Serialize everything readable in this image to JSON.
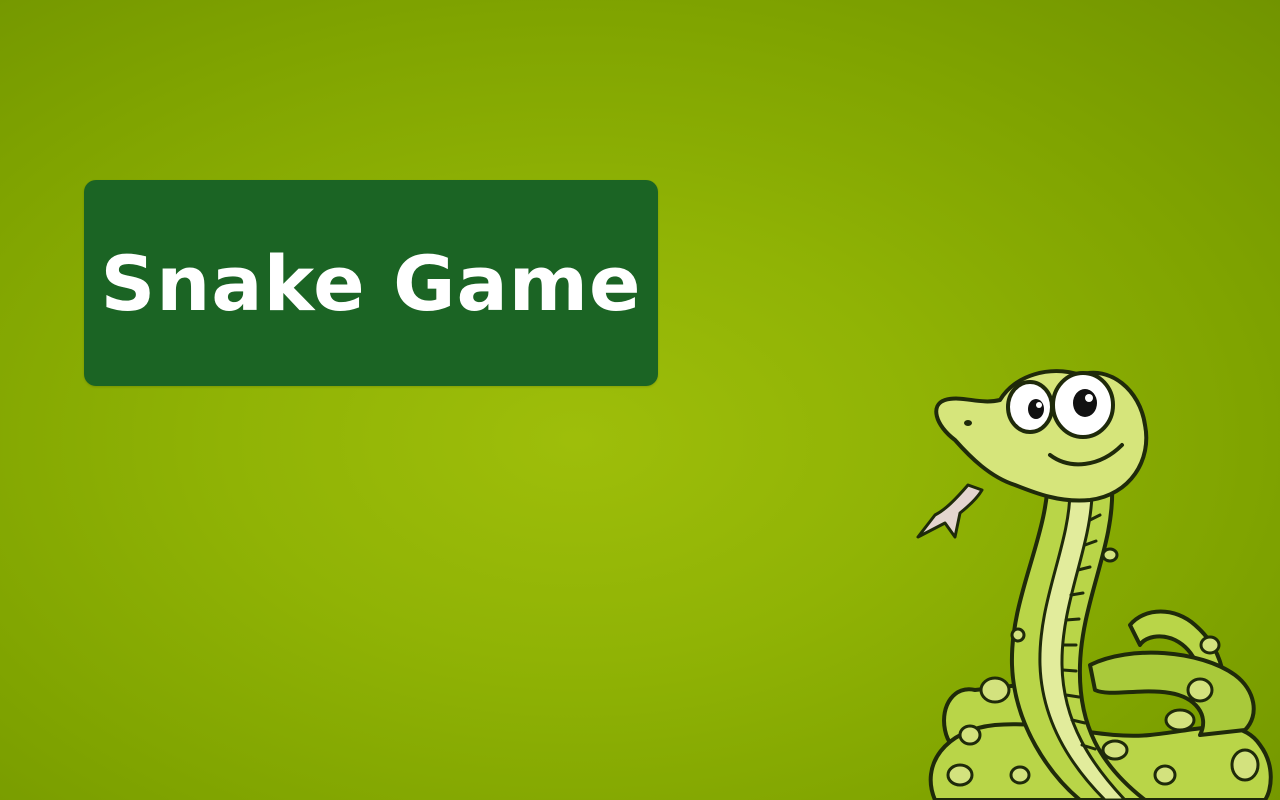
{
  "title": {
    "text": "Snake Game"
  },
  "colors": {
    "background": "#8db204",
    "title_box": "#1b6424",
    "title_text": "#ffffff",
    "snake_body": "#b9d548",
    "snake_belly": "#e2ec9c",
    "snake_outline": "#1f2a0a"
  },
  "mascot": {
    "icon": "cartoon-snake-icon"
  }
}
